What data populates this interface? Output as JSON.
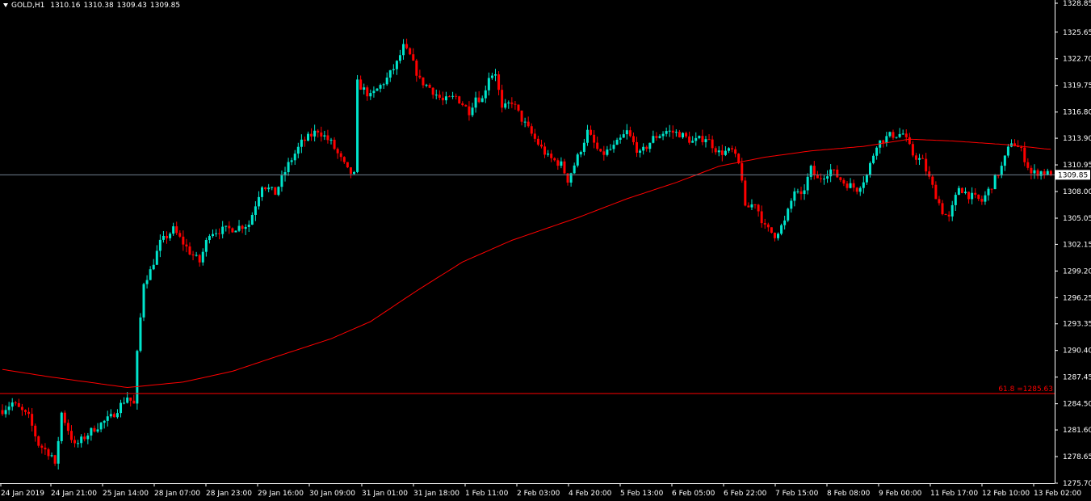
{
  "header": {
    "symbol": "GOLD,H1",
    "open": "1310.16",
    "high": "1310.38",
    "low": "1309.43",
    "close": "1309.85"
  },
  "colors": {
    "background": "#000000",
    "bull": "#00e5cc",
    "bear": "#ff0000",
    "ma": "#ff0000",
    "axis": "#ffffff",
    "bid_line": "#708090",
    "fib_line": "#ff0000"
  },
  "chart_data": {
    "type": "candlestick",
    "ylim": [
      1275.7,
      1328.85
    ],
    "y_ticks": [
      "1328.85",
      "1325.65",
      "1322.70",
      "1319.75",
      "1316.80",
      "1313.90",
      "1310.95",
      "1308.00",
      "1305.05",
      "1302.15",
      "1299.20",
      "1296.25",
      "1293.35",
      "1290.40",
      "1287.45",
      "1284.50",
      "1281.60",
      "1278.65",
      "1275.70"
    ],
    "x_labels": [
      "24 Jan 2019",
      "24 Jan 21:00",
      "25 Jan 14:00",
      "28 Jan 07:00",
      "28 Jan 23:00",
      "29 Jan 16:00",
      "30 Jan 09:00",
      "31 Jan 01:00",
      "31 Jan 18:00",
      "1 Feb 11:00",
      "2 Feb 03:00",
      "4 Feb 20:00",
      "5 Feb 13:00",
      "6 Feb 05:00",
      "6 Feb 22:00",
      "7 Feb 15:00",
      "8 Feb 08:00",
      "9 Feb 00:00",
      "11 Feb 17:00",
      "12 Feb 10:00",
      "13 Feb 02:00"
    ],
    "close_keypoints": [
      [
        0,
        1283.8
      ],
      [
        3,
        1284.6
      ],
      [
        8,
        1283.0
      ],
      [
        11,
        1280.0
      ],
      [
        15,
        1278.8
      ],
      [
        16,
        1277.5
      ],
      [
        18,
        1283.5
      ],
      [
        22,
        1279.8
      ],
      [
        28,
        1281.8
      ],
      [
        33,
        1283.0
      ],
      [
        38,
        1285.3
      ],
      [
        40,
        1284.4
      ],
      [
        41,
        1290.0
      ],
      [
        43,
        1298.0
      ],
      [
        45,
        1299.2
      ],
      [
        48,
        1302.3
      ],
      [
        52,
        1303.8
      ],
      [
        57,
        1301.3
      ],
      [
        60,
        1300.2
      ],
      [
        63,
        1303.5
      ],
      [
        70,
        1303.9
      ],
      [
        75,
        1304.4
      ],
      [
        79,
        1308.8
      ],
      [
        83,
        1307.8
      ],
      [
        87,
        1311.0
      ],
      [
        91,
        1313.4
      ],
      [
        96,
        1314.8
      ],
      [
        100,
        1313.4
      ],
      [
        105,
        1310.3
      ],
      [
        107,
        1309.8
      ],
      [
        108,
        1320.0
      ],
      [
        112,
        1318.5
      ],
      [
        117,
        1320.5
      ],
      [
        120,
        1322.2
      ],
      [
        122,
        1324.0
      ],
      [
        124,
        1323.0
      ],
      [
        127,
        1320.3
      ],
      [
        130,
        1319.5
      ],
      [
        134,
        1318.0
      ],
      [
        138,
        1318.5
      ],
      [
        142,
        1316.9
      ],
      [
        144,
        1318.5
      ],
      [
        146,
        1318.2
      ],
      [
        148,
        1320.8
      ],
      [
        150,
        1321.2
      ],
      [
        152,
        1317.0
      ],
      [
        155,
        1318.0
      ],
      [
        158,
        1316.0
      ],
      [
        162,
        1313.8
      ],
      [
        166,
        1311.8
      ],
      [
        170,
        1311.0
      ],
      [
        172,
        1309.3
      ],
      [
        175,
        1311.8
      ],
      [
        178,
        1314.6
      ],
      [
        182,
        1312.0
      ],
      [
        186,
        1312.9
      ],
      [
        190,
        1314.6
      ],
      [
        194,
        1312.1
      ],
      [
        198,
        1313.9
      ],
      [
        202,
        1314.7
      ],
      [
        206,
        1314.4
      ],
      [
        210,
        1313.5
      ],
      [
        214,
        1314.0
      ],
      [
        218,
        1312.3
      ],
      [
        222,
        1312.5
      ],
      [
        224,
        1311.0
      ],
      [
        225,
        1309.5
      ],
      [
        226,
        1306.0
      ],
      [
        229,
        1306.8
      ],
      [
        232,
        1304.0
      ],
      [
        235,
        1303.2
      ],
      [
        238,
        1304.6
      ],
      [
        241,
        1308.1
      ],
      [
        243,
        1307.3
      ],
      [
        246,
        1310.5
      ],
      [
        248,
        1309.3
      ],
      [
        252,
        1310.4
      ],
      [
        256,
        1309.0
      ],
      [
        260,
        1308.3
      ],
      [
        263,
        1309.8
      ],
      [
        266,
        1313.3
      ],
      [
        270,
        1314.2
      ],
      [
        274,
        1314.4
      ],
      [
        277,
        1312.1
      ],
      [
        280,
        1311.3
      ],
      [
        283,
        1308.5
      ],
      [
        286,
        1305.8
      ],
      [
        288,
        1305.0
      ],
      [
        291,
        1308.5
      ],
      [
        294,
        1307.6
      ],
      [
        298,
        1306.9
      ],
      [
        301,
        1308.7
      ],
      [
        304,
        1310.7
      ],
      [
        307,
        1313.6
      ],
      [
        310,
        1312.5
      ],
      [
        313,
        1310.0
      ],
      [
        316,
        1310.2
      ],
      [
        319,
        1309.85
      ]
    ],
    "ma_keypoints": [
      [
        0,
        1288.3
      ],
      [
        14,
        1287.5
      ],
      [
        38,
        1286.3
      ],
      [
        55,
        1286.9
      ],
      [
        70,
        1288.1
      ],
      [
        84,
        1289.8
      ],
      [
        100,
        1291.7
      ],
      [
        112,
        1293.6
      ],
      [
        126,
        1297.0
      ],
      [
        140,
        1300.2
      ],
      [
        155,
        1302.6
      ],
      [
        175,
        1305.1
      ],
      [
        190,
        1307.2
      ],
      [
        205,
        1309.0
      ],
      [
        218,
        1310.8
      ],
      [
        232,
        1311.8
      ],
      [
        246,
        1312.5
      ],
      [
        262,
        1313.0
      ],
      [
        276,
        1313.8
      ],
      [
        289,
        1313.6
      ],
      [
        305,
        1313.2
      ],
      [
        318,
        1312.7
      ]
    ],
    "bid_price": 1309.85,
    "bid_label": "1309.85",
    "fib_level": 1285.63,
    "fib_label": "61.8 =1285.63"
  }
}
